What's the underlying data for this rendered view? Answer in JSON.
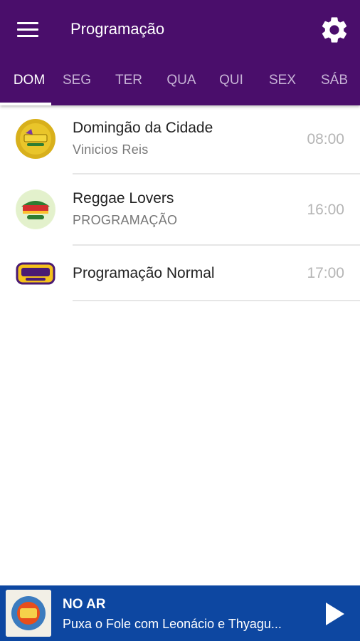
{
  "header": {
    "title": "Programação",
    "menu_icon": "menu-icon",
    "settings_icon": "gear-icon",
    "background_color": "#4a0e6b"
  },
  "tabs": [
    {
      "label": "DOM",
      "active": true
    },
    {
      "label": "SEG",
      "active": false
    },
    {
      "label": "TER",
      "active": false
    },
    {
      "label": "QUA",
      "active": false
    },
    {
      "label": "QUI",
      "active": false
    },
    {
      "label": "SEX",
      "active": false
    },
    {
      "label": "SÁB",
      "active": false
    }
  ],
  "schedule": [
    {
      "title": "Domingão da Cidade",
      "host": "Vinicios Reis",
      "time": "08:00"
    },
    {
      "title": "Reggae Lovers",
      "host": "PROGRAMAÇÃO",
      "time": "16:00"
    },
    {
      "title": "Programação Normal",
      "host": "",
      "time": "17:00"
    }
  ],
  "player": {
    "label": "NO AR",
    "track": "Puxa o Fole com Leonácio e Thyagu...",
    "play_icon": "play-icon",
    "background_color": "#0d47a1"
  }
}
